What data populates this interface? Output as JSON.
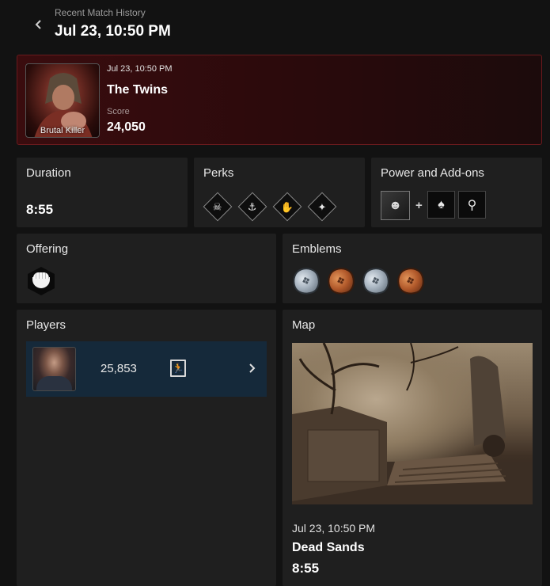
{
  "header": {
    "subtitle": "Recent Match History",
    "title": "Jul 23, 10:50 PM"
  },
  "match": {
    "role_label": "Brutal Killer",
    "date": "Jul 23, 10:50 PM",
    "killer": "The Twins",
    "score_label": "Score",
    "score": "24,050"
  },
  "duration": {
    "title": "Duration",
    "value": "8:55"
  },
  "perks": {
    "title": "Perks",
    "icons": [
      "perk-icon-1",
      "perk-icon-2",
      "perk-icon-3",
      "perk-icon-4"
    ]
  },
  "power": {
    "title": "Power and Add-ons",
    "plus": "+"
  },
  "offering": {
    "title": "Offering"
  },
  "emblems": {
    "title": "Emblems",
    "items": [
      {
        "tier": "silver"
      },
      {
        "tier": "bronze"
      },
      {
        "tier": "silver"
      },
      {
        "tier": "bronze"
      }
    ]
  },
  "players": {
    "title": "Players",
    "rows": [
      {
        "score": "25,853",
        "status_icon": "escape-icon"
      }
    ]
  },
  "map": {
    "title": "Map",
    "date": "Jul 23, 10:50 PM",
    "name": "Dead Sands",
    "duration": "8:55"
  }
}
